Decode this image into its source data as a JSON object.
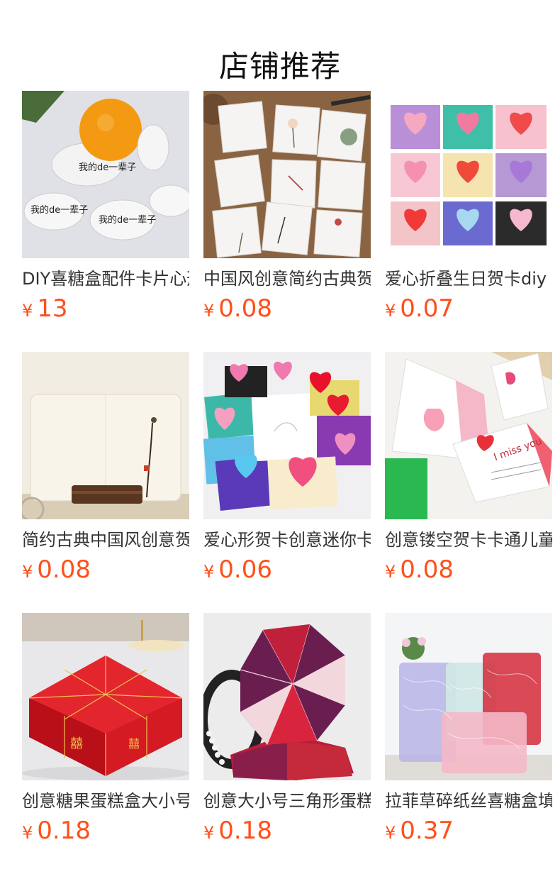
{
  "page": {
    "title": "店铺推荐"
  },
  "colors": {
    "price": "#ff4f1a",
    "title_text": "#111111",
    "name_text": "#333333"
  },
  "products": [
    {
      "name": "DIY喜糖盒配件卡片心形",
      "currency": "¥",
      "price": "13",
      "image": "orange-candy-tag-cards-image"
    },
    {
      "name": "中国风创意简约古典贺卡",
      "currency": "¥",
      "price": "0.08",
      "image": "chinese-style-flower-cards-image"
    },
    {
      "name": "爱心折叠生日贺卡diy",
      "currency": "¥",
      "price": "0.07",
      "image": "heart-fold-birthday-cards-image"
    },
    {
      "name": "简约古典中国风创意贺卡",
      "currency": "¥",
      "price": "0.08",
      "image": "classic-chinese-card-stand-image"
    },
    {
      "name": "爱心形贺卡创意迷你卡片",
      "currency": "¥",
      "price": "0.06",
      "image": "heart-shape-mini-cards-image"
    },
    {
      "name": "创意镂空贺卡卡通儿童",
      "currency": "¥",
      "price": "0.08",
      "image": "hollow-cartoon-cards-image"
    },
    {
      "name": "创意糖果蛋糕盒大小号",
      "currency": "¥",
      "price": "0.18",
      "image": "red-cake-candy-box-image"
    },
    {
      "name": "创意大小号三角形蛋糕盒",
      "currency": "¥",
      "price": "0.18",
      "image": "triangle-cake-box-image"
    },
    {
      "name": "拉菲草碎纸丝喜糖盒填充",
      "currency": "¥",
      "price": "0.37",
      "image": "raffia-shredded-paper-image"
    }
  ]
}
